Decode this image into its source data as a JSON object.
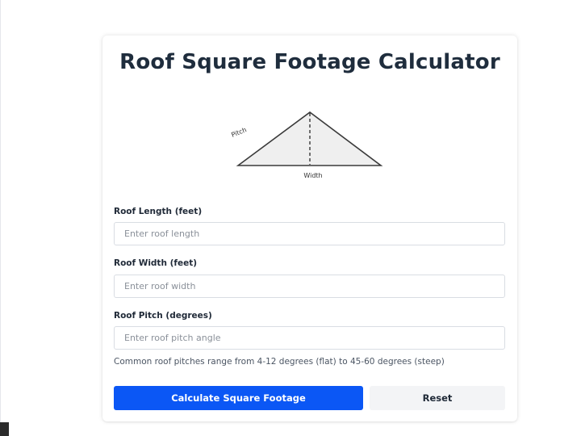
{
  "page": {
    "title": "Roof Square Footage Calculator"
  },
  "diagram": {
    "pitch_label": "Pitch",
    "width_label": "Width"
  },
  "form": {
    "length": {
      "label": "Roof Length (feet)",
      "placeholder": "Enter roof length",
      "value": ""
    },
    "width": {
      "label": "Roof Width (feet)",
      "placeholder": "Enter roof width",
      "value": ""
    },
    "pitch": {
      "label": "Roof Pitch (degrees)",
      "placeholder": "Enter roof pitch angle",
      "value": ""
    },
    "hint": "Common roof pitches range from 4-12 degrees (flat) to 45-60 degrees (steep)"
  },
  "actions": {
    "calculate_label": "Calculate Square Footage",
    "reset_label": "Reset"
  },
  "colors": {
    "primary": "#0b57f5",
    "secondary_bg": "#f3f4f6",
    "title": "#1f2d3d"
  }
}
